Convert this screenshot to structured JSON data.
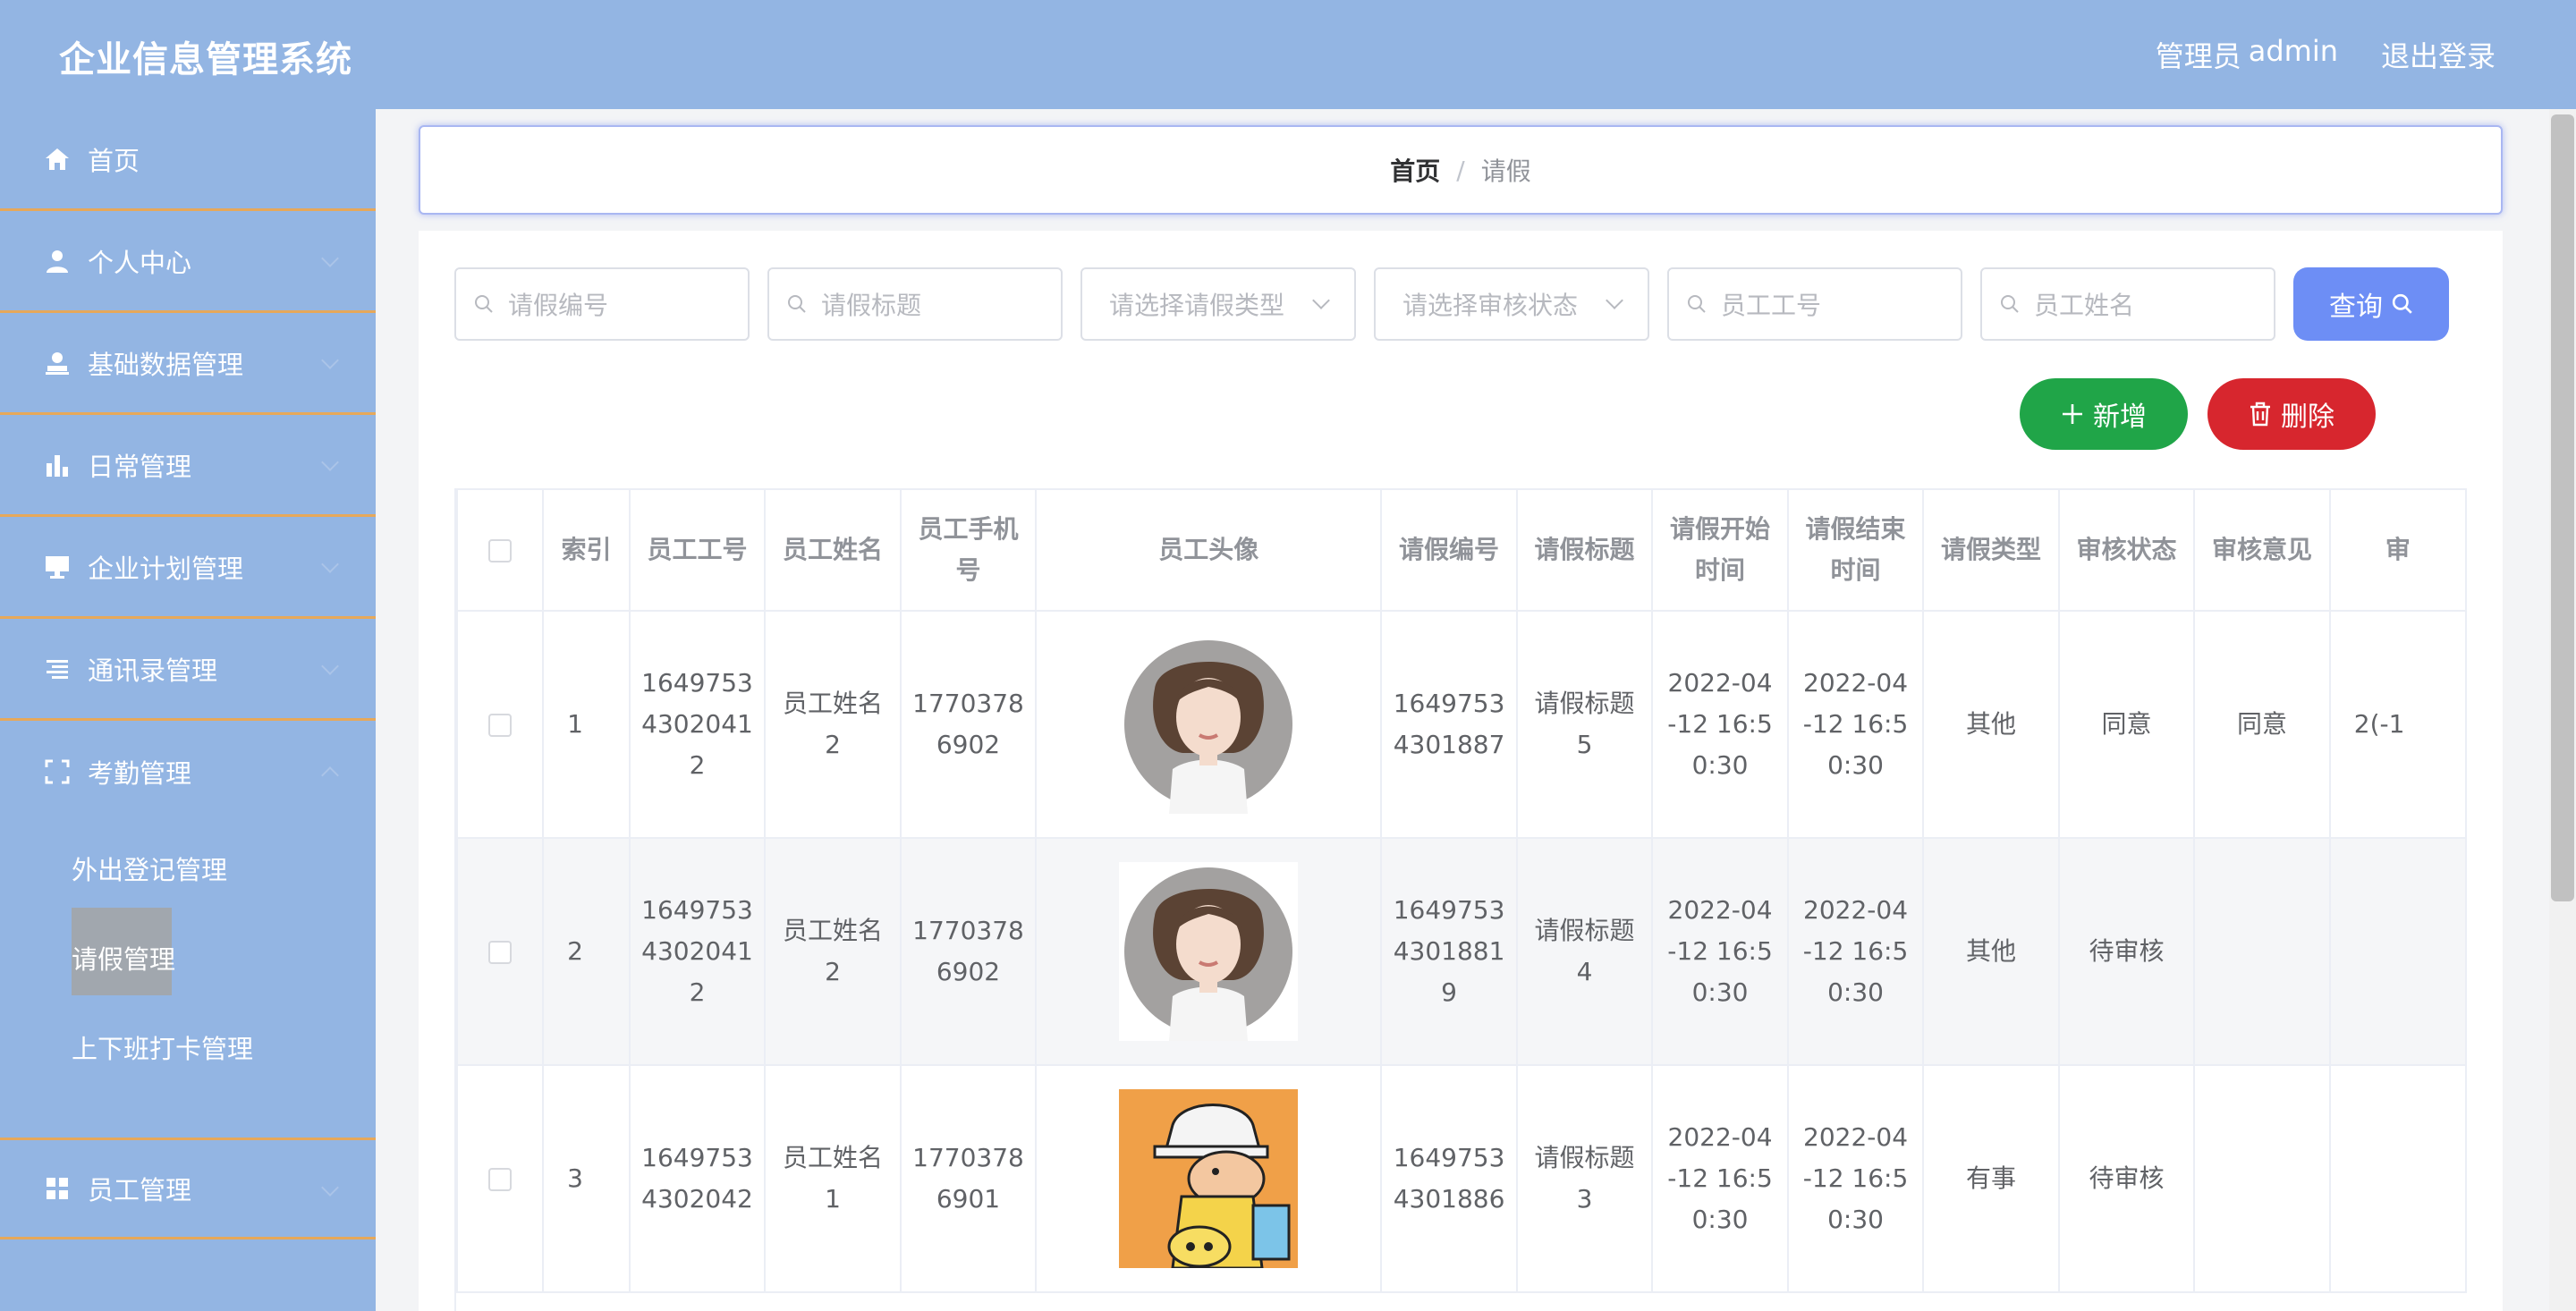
{
  "header": {
    "title": "企业信息管理系统",
    "role": "管理员",
    "user": "admin",
    "logout": "退出登录"
  },
  "sidebar": {
    "items": [
      {
        "label": "首页",
        "icon": "home-icon"
      },
      {
        "label": "个人中心",
        "icon": "user-icon"
      },
      {
        "label": "基础数据管理",
        "icon": "user-stand-icon"
      },
      {
        "label": "日常管理",
        "icon": "bar-chart-icon"
      },
      {
        "label": "企业计划管理",
        "icon": "monitor-icon"
      },
      {
        "label": "通讯录管理",
        "icon": "list-icon"
      },
      {
        "label": "考勤管理",
        "icon": "fullscreen-icon"
      },
      {
        "label": "员工管理",
        "icon": "grid-icon"
      }
    ],
    "sub_items": [
      "外出登记管理",
      "请假管理",
      "上下班打卡管理"
    ],
    "active_sub": "请假管理"
  },
  "breadcrumb": {
    "home": "首页",
    "separator": "/",
    "current": "请假"
  },
  "filters": {
    "leave_no": "请假编号",
    "leave_title": "请假标题",
    "leave_type": "请选择请假类型",
    "audit_status": "请选择审核状态",
    "emp_no": "员工工号",
    "emp_name": "员工姓名"
  },
  "buttons": {
    "search": "查询",
    "add": "新增",
    "delete": "删除"
  },
  "table": {
    "headers": [
      "索引",
      "员工工号",
      "员工姓名",
      "员工手机号",
      "员工头像",
      "请假编号",
      "请假标题",
      "请假开始时间",
      "请假结束时间",
      "请假类型",
      "审核状态",
      "审核意见",
      "审"
    ],
    "rows": [
      {
        "index": "1",
        "emp_no": "16497534302041 2",
        "emp_name": "员工姓名2",
        "phone": "17703786902",
        "avatar": "girl",
        "leave_no": "16497534301887",
        "title": "请假标题5",
        "start": "2022-04-12 16:50:30",
        "end": "2022-04-12 16:50:30",
        "type": "其他",
        "status": "同意",
        "opinion": "同意",
        "extra": "2(-1"
      },
      {
        "index": "2",
        "emp_no": "16497534302041 2",
        "emp_name": "员工姓名2",
        "phone": "17703786902",
        "avatar": "girl",
        "leave_no": "16497534301881 9",
        "title": "请假标题4",
        "start": "2022-04-12 16:50:30",
        "end": "2022-04-12 16:50:30",
        "type": "其他",
        "status": "待审核",
        "opinion": "",
        "extra": ""
      },
      {
        "index": "3",
        "emp_no": "16497534302042",
        "emp_name": "员工姓名1",
        "phone": "17703786901",
        "avatar": "cartoon",
        "leave_no": "16497534301886",
        "title": "请假标题3",
        "start": "2022-04-12 16:50:30",
        "end": "2022-04-12 16:50:30",
        "type": "有事",
        "status": "待审核",
        "opinion": "",
        "extra": ""
      }
    ]
  },
  "colors": {
    "header_bg": "#93b5e3",
    "accent_border": "#e6a85a",
    "search_btn": "#6d8ef5",
    "add_btn": "#20a548",
    "delete_btn": "#d7262e"
  }
}
